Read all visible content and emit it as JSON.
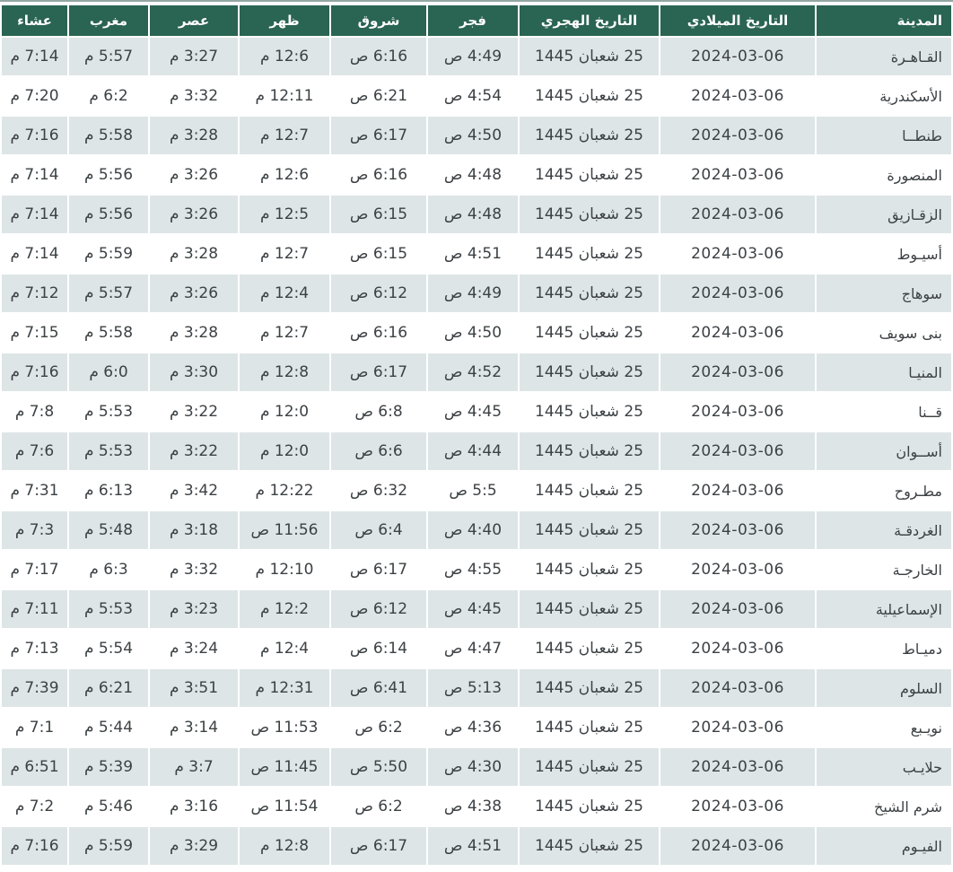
{
  "colors": {
    "header_bg": "#2a6452",
    "row_alt_bg": "#dee5e6",
    "row_bg": "#ffffff",
    "header_text": "#ffffff",
    "text": "#3c4144",
    "top_edge": "#93a8a3"
  },
  "table": {
    "headers": {
      "city": "المدينة",
      "gregorian": "التاريخ الميلادي",
      "hijri": "التاريخ الهجري",
      "fajr": "فجر",
      "shorouq": "شروق",
      "dhuhr": "ظهر",
      "asr": "عصر",
      "maghrib": "مغرب",
      "isha": "عشاء"
    },
    "rows": [
      {
        "city": "القـاهـرة",
        "gregorian": "2024-03-06",
        "hijri": "25 شعبان 1445",
        "fajr": "4:49 ص",
        "shorouq": "6:16 ص",
        "dhuhr": "12:6 م",
        "asr": "3:27 م",
        "maghrib": "5:57 م",
        "isha": "7:14 م"
      },
      {
        "city": "الأسكندرية",
        "gregorian": "2024-03-06",
        "hijri": "25 شعبان 1445",
        "fajr": "4:54 ص",
        "shorouq": "6:21 ص",
        "dhuhr": "12:11 م",
        "asr": "3:32 م",
        "maghrib": "6:2 م",
        "isha": "7:20 م"
      },
      {
        "city": "طنطــا",
        "gregorian": "2024-03-06",
        "hijri": "25 شعبان 1445",
        "fajr": "4:50 ص",
        "shorouq": "6:17 ص",
        "dhuhr": "12:7 م",
        "asr": "3:28 م",
        "maghrib": "5:58 م",
        "isha": "7:16 م"
      },
      {
        "city": "المنصورة",
        "gregorian": "2024-03-06",
        "hijri": "25 شعبان 1445",
        "fajr": "4:48 ص",
        "shorouq": "6:16 ص",
        "dhuhr": "12:6 م",
        "asr": "3:26 م",
        "maghrib": "5:56 م",
        "isha": "7:14 م"
      },
      {
        "city": "الزقـازيق",
        "gregorian": "2024-03-06",
        "hijri": "25 شعبان 1445",
        "fajr": "4:48 ص",
        "shorouq": "6:15 ص",
        "dhuhr": "12:5 م",
        "asr": "3:26 م",
        "maghrib": "5:56 م",
        "isha": "7:14 م"
      },
      {
        "city": "أسيـوط",
        "gregorian": "2024-03-06",
        "hijri": "25 شعبان 1445",
        "fajr": "4:51 ص",
        "shorouq": "6:15 ص",
        "dhuhr": "12:7 م",
        "asr": "3:28 م",
        "maghrib": "5:59 م",
        "isha": "7:14 م"
      },
      {
        "city": "سوهاج",
        "gregorian": "2024-03-06",
        "hijri": "25 شعبان 1445",
        "fajr": "4:49 ص",
        "shorouq": "6:12 ص",
        "dhuhr": "12:4 م",
        "asr": "3:26 م",
        "maghrib": "5:57 م",
        "isha": "7:12 م"
      },
      {
        "city": "بنى سويف",
        "gregorian": "2024-03-06",
        "hijri": "25 شعبان 1445",
        "fajr": "4:50 ص",
        "shorouq": "6:16 ص",
        "dhuhr": "12:7 م",
        "asr": "3:28 م",
        "maghrib": "5:58 م",
        "isha": "7:15 م"
      },
      {
        "city": "المنيـا",
        "gregorian": "2024-03-06",
        "hijri": "25 شعبان 1445",
        "fajr": "4:52 ص",
        "shorouq": "6:17 ص",
        "dhuhr": "12:8 م",
        "asr": "3:30 م",
        "maghrib": "6:0 م",
        "isha": "7:16 م"
      },
      {
        "city": "قــنا",
        "gregorian": "2024-03-06",
        "hijri": "25 شعبان 1445",
        "fajr": "4:45 ص",
        "shorouq": "6:8 ص",
        "dhuhr": "12:0 م",
        "asr": "3:22 م",
        "maghrib": "5:53 م",
        "isha": "7:8 م"
      },
      {
        "city": "أســوان",
        "gregorian": "2024-03-06",
        "hijri": "25 شعبان 1445",
        "fajr": "4:44 ص",
        "shorouq": "6:6 ص",
        "dhuhr": "12:0 م",
        "asr": "3:22 م",
        "maghrib": "5:53 م",
        "isha": "7:6 م"
      },
      {
        "city": "مطـروح",
        "gregorian": "2024-03-06",
        "hijri": "25 شعبان 1445",
        "fajr": "5:5 ص",
        "shorouq": "6:32 ص",
        "dhuhr": "12:22 م",
        "asr": "3:42 م",
        "maghrib": "6:13 م",
        "isha": "7:31 م"
      },
      {
        "city": "الغردقـة",
        "gregorian": "2024-03-06",
        "hijri": "25 شعبان 1445",
        "fajr": "4:40 ص",
        "shorouq": "6:4 ص",
        "dhuhr": "11:56 ص",
        "asr": "3:18 م",
        "maghrib": "5:48 م",
        "isha": "7:3 م"
      },
      {
        "city": "الخارجـة",
        "gregorian": "2024-03-06",
        "hijri": "25 شعبان 1445",
        "fajr": "4:55 ص",
        "shorouq": "6:17 ص",
        "dhuhr": "12:10 م",
        "asr": "3:32 م",
        "maghrib": "6:3 م",
        "isha": "7:17 م"
      },
      {
        "city": "الإسماعيلية",
        "gregorian": "2024-03-06",
        "hijri": "25 شعبان 1445",
        "fajr": "4:45 ص",
        "shorouq": "6:12 ص",
        "dhuhr": "12:2 م",
        "asr": "3:23 م",
        "maghrib": "5:53 م",
        "isha": "7:11 م"
      },
      {
        "city": "دميـاط",
        "gregorian": "2024-03-06",
        "hijri": "25 شعبان 1445",
        "fajr": "4:47 ص",
        "shorouq": "6:14 ص",
        "dhuhr": "12:4 م",
        "asr": "3:24 م",
        "maghrib": "5:54 م",
        "isha": "7:13 م"
      },
      {
        "city": "السلوم",
        "gregorian": "2024-03-06",
        "hijri": "25 شعبان 1445",
        "fajr": "5:13 ص",
        "shorouq": "6:41 ص",
        "dhuhr": "12:31 م",
        "asr": "3:51 م",
        "maghrib": "6:21 م",
        "isha": "7:39 م"
      },
      {
        "city": "نويـبع",
        "gregorian": "2024-03-06",
        "hijri": "25 شعبان 1445",
        "fajr": "4:36 ص",
        "shorouq": "6:2 ص",
        "dhuhr": "11:53 ص",
        "asr": "3:14 م",
        "maghrib": "5:44 م",
        "isha": "7:1 م"
      },
      {
        "city": "حلايـب",
        "gregorian": "2024-03-06",
        "hijri": "25 شعبان 1445",
        "fajr": "4:30 ص",
        "shorouq": "5:50 ص",
        "dhuhr": "11:45 ص",
        "asr": "3:7 م",
        "maghrib": "5:39 م",
        "isha": "6:51 م"
      },
      {
        "city": "شرم الشيخ",
        "gregorian": "2024-03-06",
        "hijri": "25 شعبان 1445",
        "fajr": "4:38 ص",
        "shorouq": "6:2 ص",
        "dhuhr": "11:54 ص",
        "asr": "3:16 م",
        "maghrib": "5:46 م",
        "isha": "7:2 م"
      },
      {
        "city": "الفيـوم",
        "gregorian": "2024-03-06",
        "hijri": "25 شعبان 1445",
        "fajr": "4:51 ص",
        "shorouq": "6:17 ص",
        "dhuhr": "12:8 م",
        "asr": "3:29 م",
        "maghrib": "5:59 م",
        "isha": "7:16 م"
      }
    ]
  }
}
